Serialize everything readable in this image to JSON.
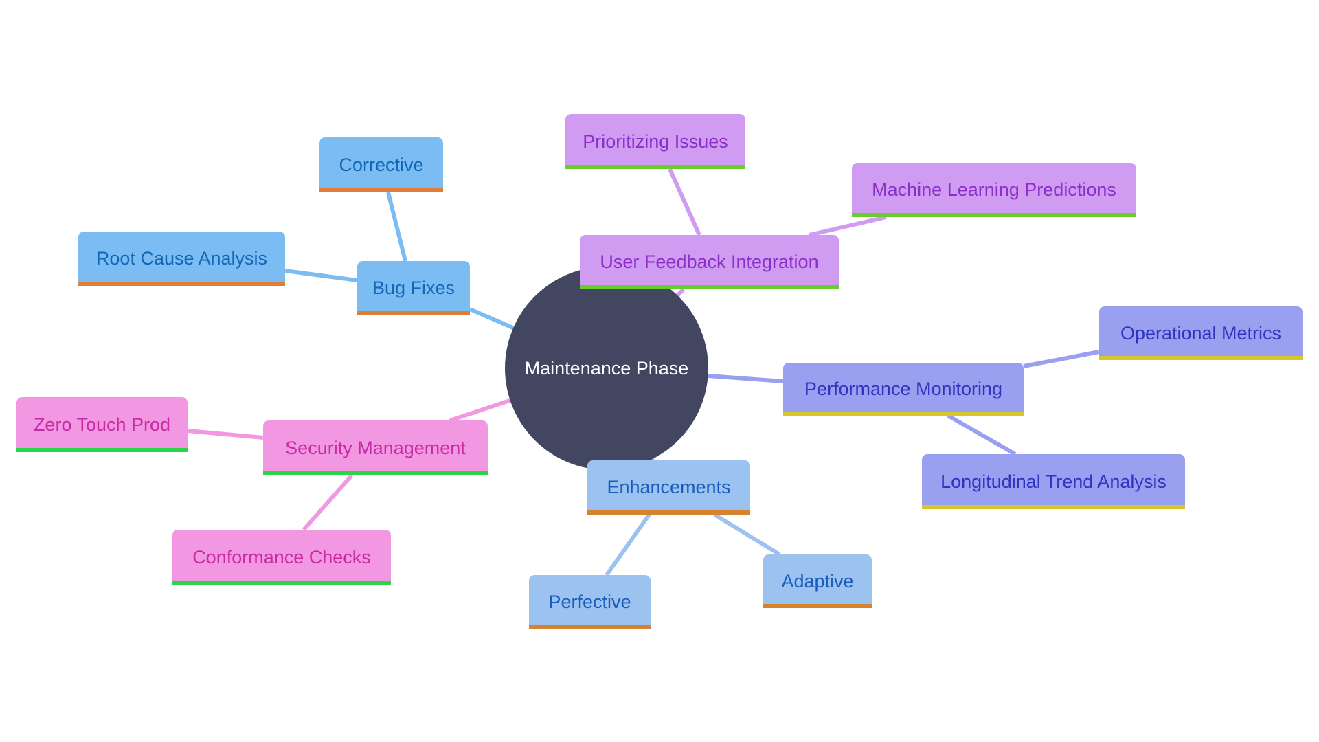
{
  "diagram": {
    "type": "mindmap",
    "root": {
      "id": "root",
      "label": "Maintenance Phase",
      "color": "#424660"
    },
    "branches": [
      {
        "id": "bug-fixes",
        "label": "Bug Fixes",
        "fill": "#7bbdf2",
        "text": "#1466b8",
        "underline": "#e07e38",
        "edge": "#7bbdf2",
        "children": [
          {
            "id": "corrective",
            "label": "Corrective"
          },
          {
            "id": "root-cause",
            "label": "Root Cause Analysis"
          }
        ]
      },
      {
        "id": "user-feedback",
        "label": "User Feedback Integration",
        "fill": "#cf9cf2",
        "text": "#8a2fc9",
        "underline": "#68cc2a",
        "edge": "#cf9cf2",
        "children": [
          {
            "id": "prioritizing",
            "label": "Prioritizing Issues"
          },
          {
            "id": "ml-predictions",
            "label": "Machine Learning Predictions"
          }
        ]
      },
      {
        "id": "performance",
        "label": "Performance Monitoring",
        "fill": "#9aa0f0",
        "text": "#2f35c0",
        "underline": "#d7c62a",
        "edge": "#9aa0f0",
        "children": [
          {
            "id": "operational",
            "label": "Operational Metrics"
          },
          {
            "id": "longitudinal",
            "label": "Longitudinal Trend Analysis"
          }
        ]
      },
      {
        "id": "security",
        "label": "Security Management",
        "fill": "#f298e2",
        "text": "#c82aa4",
        "underline": "#2ad548",
        "edge": "#f298e2",
        "children": [
          {
            "id": "zero-touch",
            "label": "Zero Touch Prod"
          },
          {
            "id": "conformance",
            "label": "Conformance Checks"
          }
        ]
      },
      {
        "id": "enhancements",
        "label": "Enhancements",
        "fill": "#9cc3f0",
        "text": "#1a5cbd",
        "underline": "#d5832e",
        "edge": "#9cc3f0",
        "children": [
          {
            "id": "perfective",
            "label": "Perfective"
          },
          {
            "id": "adaptive",
            "label": "Adaptive"
          }
        ]
      }
    ]
  }
}
